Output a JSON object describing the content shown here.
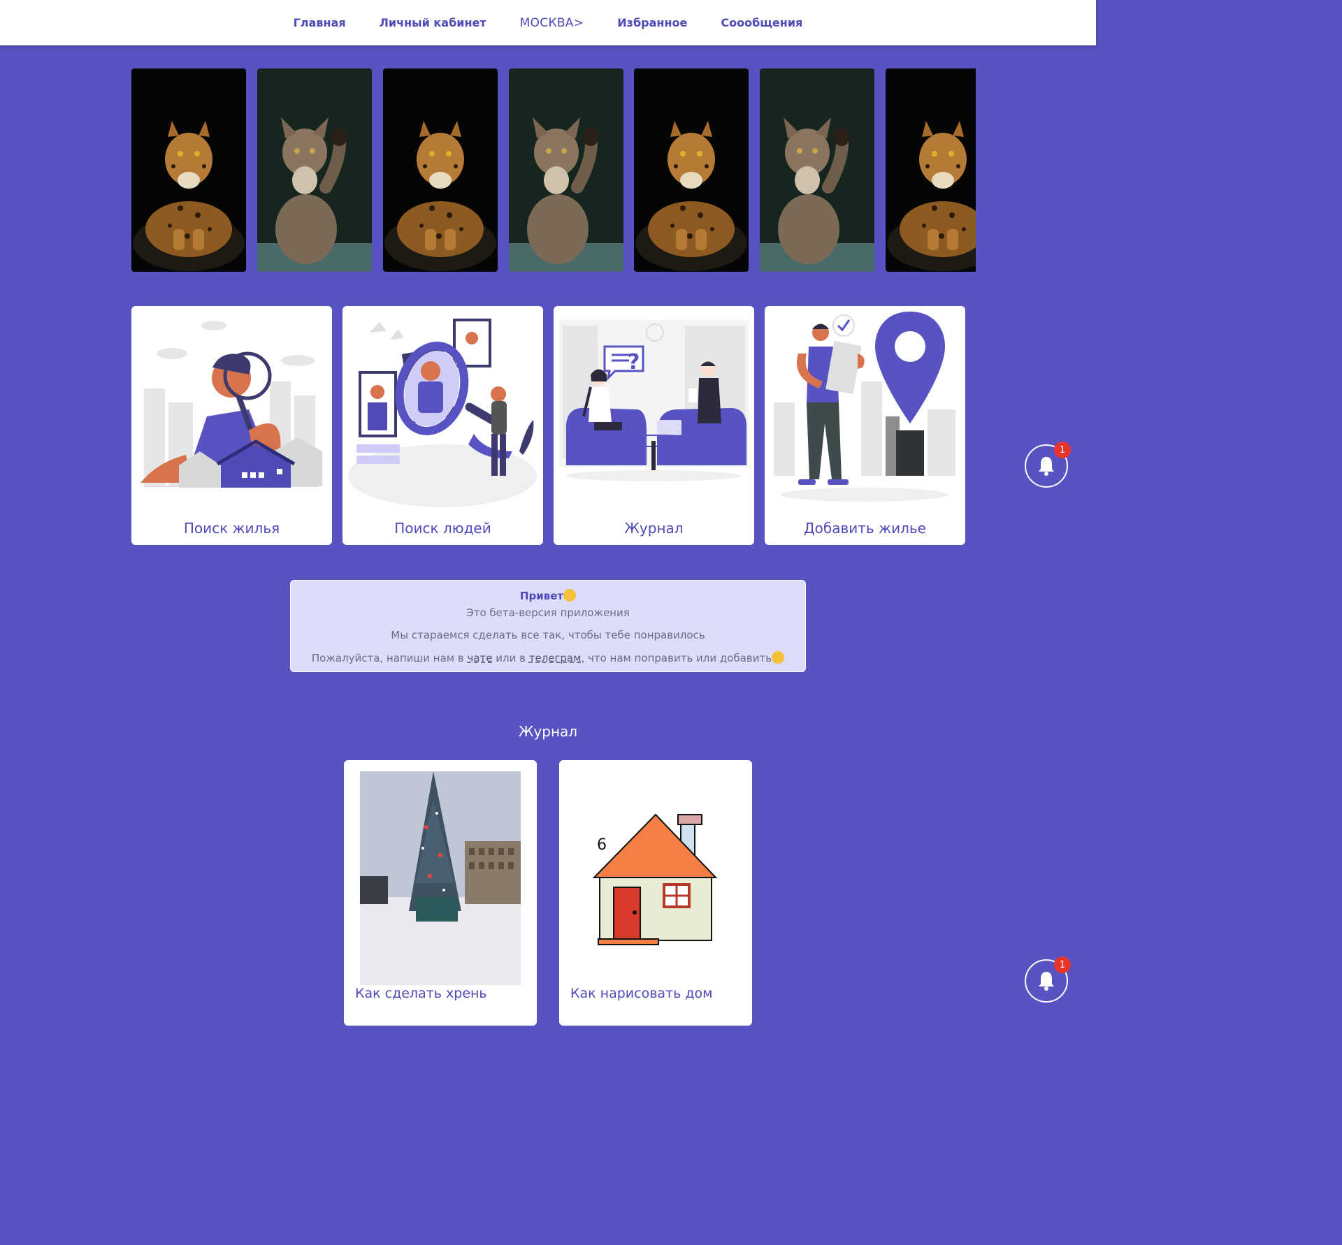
{
  "nav": {
    "home": "Главная",
    "account": "Личный кабинет",
    "city": "МОСКВА>",
    "favorites": "Избранное",
    "messages": "Соообщения"
  },
  "stories": [
    {
      "subject": "leopard"
    },
    {
      "subject": "cat"
    },
    {
      "subject": "leopard"
    },
    {
      "subject": "cat"
    },
    {
      "subject": "leopard"
    },
    {
      "subject": "cat"
    },
    {
      "subject": "leopard"
    }
  ],
  "cards": [
    {
      "label": "Поиск жилья"
    },
    {
      "label": "Поиск людей"
    },
    {
      "label": "Журнал"
    },
    {
      "label": "Добавить жилье"
    }
  ],
  "notice": {
    "greeting": "Привет",
    "line1": "Это бета-версия приложения",
    "line2": "Мы стараемся сделать все так, чтобы тебе понравилось",
    "line3_start": "Пожалуйста, напиши нам в ",
    "chat_link": "чате",
    "line3_mid": " или в ",
    "telegram_link": "телеграм",
    "line3_end": ", что нам поправить или добавить"
  },
  "journal": {
    "title": "Журнал",
    "articles": [
      {
        "title": "Как сделать хрень"
      },
      {
        "title": "Как нарисовать дом",
        "number": "6"
      }
    ]
  },
  "notifications": {
    "count": "1"
  },
  "colors": {
    "accent": "#5753c3",
    "text": "#4e4ab8",
    "notice_bg": "#dddcfb",
    "badge": "#e8352a"
  }
}
